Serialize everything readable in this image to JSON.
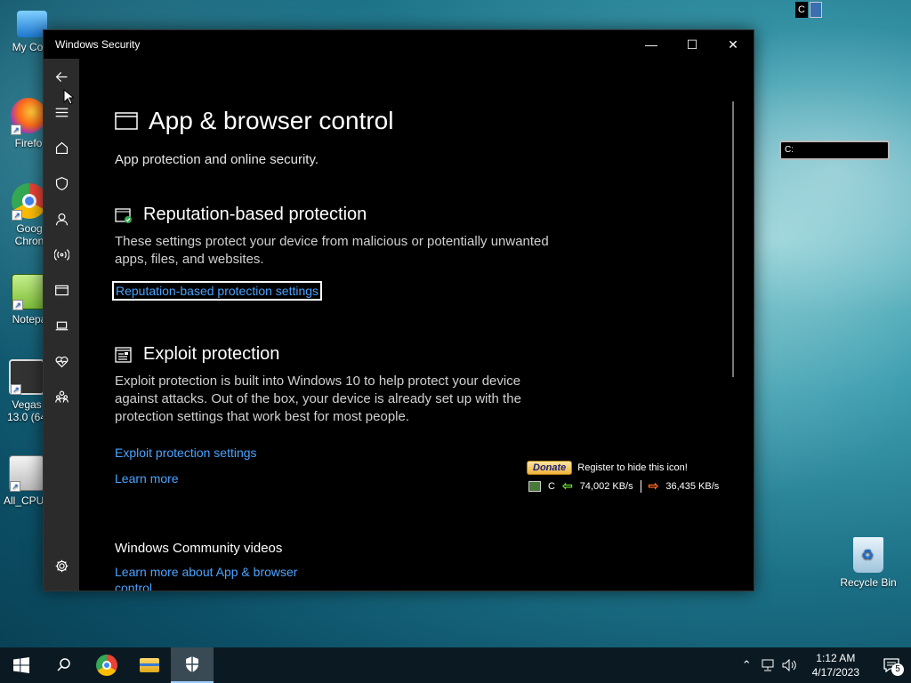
{
  "desktop": {
    "icons": [
      {
        "label": "My Com",
        "name": "my-computer"
      },
      {
        "label": "Firefo",
        "name": "firefox"
      },
      {
        "label": "Goog\nChron",
        "name": "google-chrome"
      },
      {
        "label": "Notepa",
        "name": "notepad"
      },
      {
        "label": "Vegas\n13.0 (64",
        "name": "vegas"
      },
      {
        "label": "All_CPU_",
        "name": "all-cpu"
      },
      {
        "label": "Recycle Bin",
        "name": "recycle-bin"
      }
    ],
    "top_widget_letter": "C",
    "graph_label": "C:"
  },
  "window": {
    "title": "Windows Security",
    "minimize": "—",
    "maximize": "☐",
    "close": "✕"
  },
  "content": {
    "page_title": "App & browser control",
    "page_subtitle": "App protection and online security.",
    "reputation": {
      "title": "Reputation-based protection",
      "description": "These settings protect your device from malicious or potentially unwanted apps, files, and websites.",
      "link": "Reputation-based protection settings"
    },
    "exploit": {
      "title": "Exploit protection",
      "description": "Exploit protection is built into Windows 10 to help protect your device against attacks.  Out of the box, your device is already set up with the protection settings that work best for most people.",
      "link": "Exploit protection settings",
      "learn_more": "Learn more"
    },
    "community": {
      "title": "Windows Community videos",
      "link": "Learn more about App & browser control"
    }
  },
  "overlay": {
    "donate": "Donate",
    "register": "Register to hide this icon!",
    "drive": "C",
    "download_speed": "74,002 KB/s",
    "upload_speed": "36,435 KB/s"
  },
  "taskbar": {
    "time": "1:12 AM",
    "date": "4/17/2023",
    "notification_count": "5"
  }
}
